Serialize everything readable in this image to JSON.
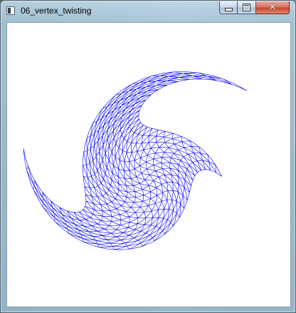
{
  "window": {
    "title": "06_vertex_twisting",
    "icon": "app-window-icon",
    "controls": {
      "minimize_icon": "minimize-icon",
      "maximize_icon": "maximize-icon",
      "close_icon": "close-icon",
      "close_glyph": "✕"
    }
  },
  "canvas": {
    "background": "#ffffff",
    "mesh_color": "#0000ff",
    "mesh": "twisted triangle grid"
  }
}
